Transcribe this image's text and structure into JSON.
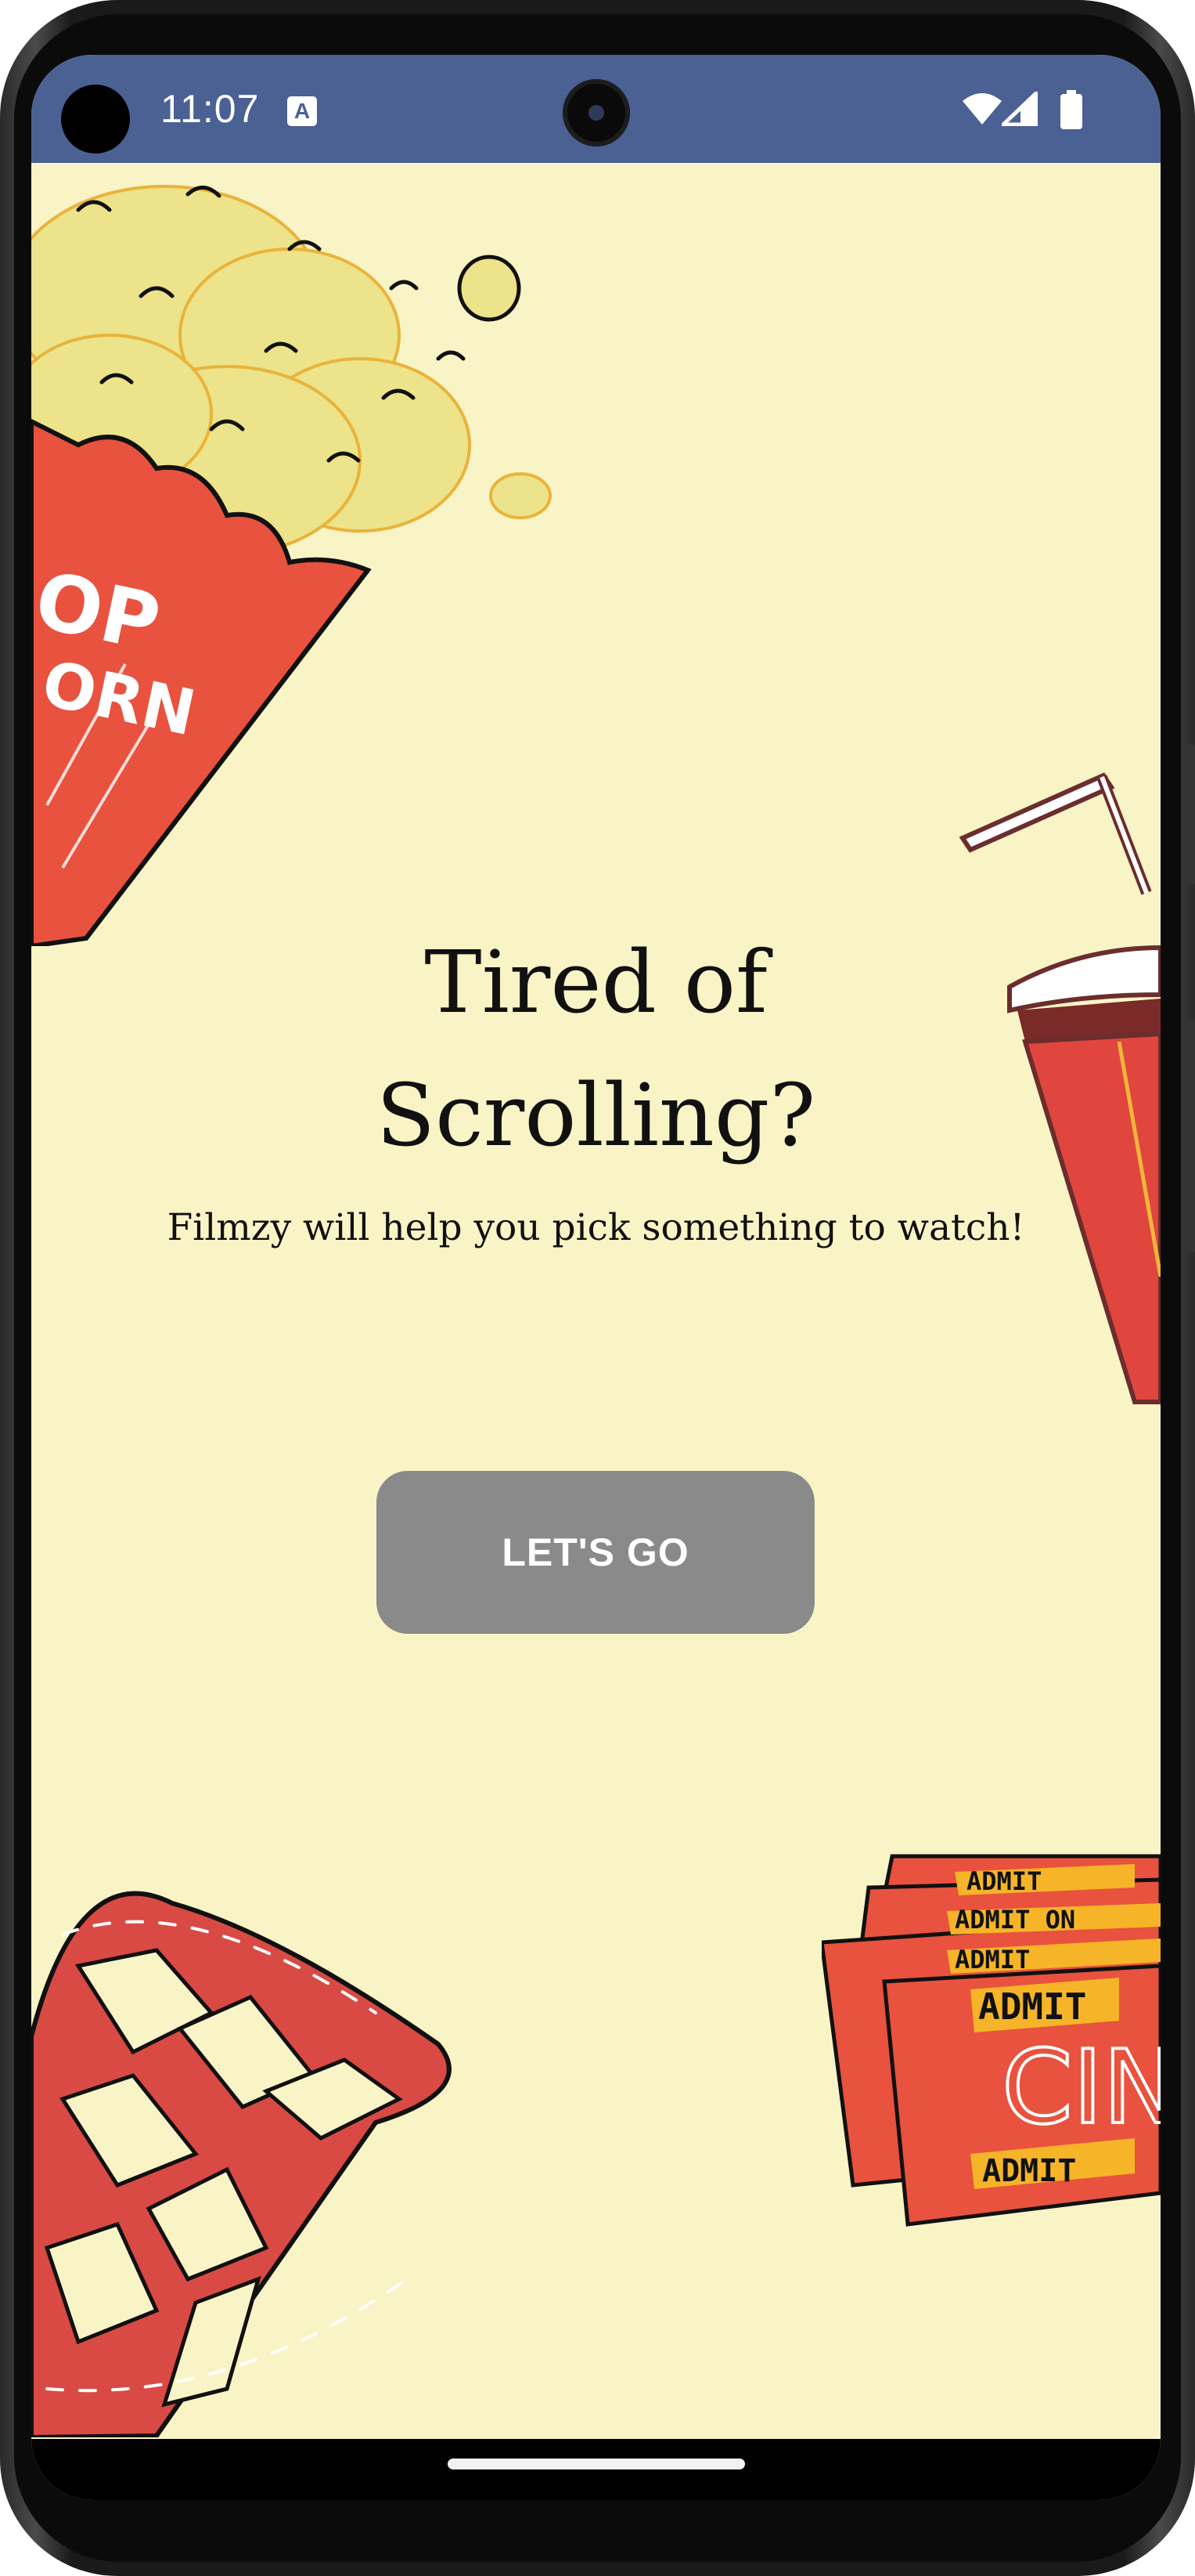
{
  "status_bar": {
    "time": "11:07",
    "notification_icon": "A",
    "icons": [
      "wifi-icon",
      "signal-icon",
      "battery-icon"
    ]
  },
  "decorations": {
    "popcorn": {
      "label_line1": "OP",
      "label_line2": "ORN"
    },
    "ticket": {
      "line1": "ADMIT",
      "line2": "ADMIT ON",
      "line3": "ADMIT",
      "line4": "ADMIT",
      "brand": "CINE",
      "line5": "ADMIT"
    }
  },
  "main": {
    "headline_line1": "Tired of",
    "headline_line2": "Scrolling?",
    "tagline": "Filmzy will help you pick something to watch!",
    "cta_label": "LET'S GO"
  },
  "colors": {
    "background": "#f9f4c6",
    "status_bar": "#4b6194",
    "button": "#8a8a8a",
    "accent_red": "#e8523e",
    "popcorn_yellow": "#ece38a"
  }
}
